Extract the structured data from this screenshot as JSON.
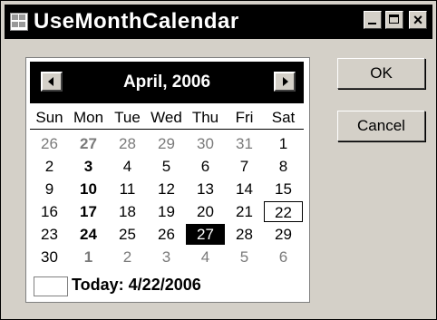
{
  "window": {
    "title": "UseMonthCalendar",
    "close_glyph": "×"
  },
  "calendar": {
    "month_label": "April, 2006",
    "days_of_week": [
      "Sun",
      "Mon",
      "Tue",
      "Wed",
      "Thu",
      "Fri",
      "Sat"
    ],
    "weeks": [
      [
        {
          "d": "26",
          "other": true
        },
        {
          "d": "27",
          "other": true,
          "bold": true
        },
        {
          "d": "28",
          "other": true
        },
        {
          "d": "29",
          "other": true
        },
        {
          "d": "30",
          "other": true
        },
        {
          "d": "31",
          "other": true
        },
        {
          "d": "1"
        }
      ],
      [
        {
          "d": "2"
        },
        {
          "d": "3",
          "bold": true
        },
        {
          "d": "4"
        },
        {
          "d": "5"
        },
        {
          "d": "6"
        },
        {
          "d": "7"
        },
        {
          "d": "8"
        }
      ],
      [
        {
          "d": "9"
        },
        {
          "d": "10",
          "bold": true
        },
        {
          "d": "11"
        },
        {
          "d": "12"
        },
        {
          "d": "13"
        },
        {
          "d": "14"
        },
        {
          "d": "15"
        }
      ],
      [
        {
          "d": "16"
        },
        {
          "d": "17",
          "bold": true
        },
        {
          "d": "18"
        },
        {
          "d": "19"
        },
        {
          "d": "20"
        },
        {
          "d": "21"
        },
        {
          "d": "22",
          "today": true
        }
      ],
      [
        {
          "d": "23"
        },
        {
          "d": "24",
          "bold": true
        },
        {
          "d": "25"
        },
        {
          "d": "26"
        },
        {
          "d": "27",
          "selected": true
        },
        {
          "d": "28"
        },
        {
          "d": "29"
        }
      ],
      [
        {
          "d": "30"
        },
        {
          "d": "1",
          "other": true,
          "bold": true
        },
        {
          "d": "2",
          "other": true
        },
        {
          "d": "3",
          "other": true
        },
        {
          "d": "4",
          "other": true
        },
        {
          "d": "5",
          "other": true
        },
        {
          "d": "6",
          "other": true
        }
      ]
    ],
    "today_label": "Today: 4/22/2006"
  },
  "buttons": {
    "ok_label": "OK",
    "cancel_label": "Cancel"
  }
}
